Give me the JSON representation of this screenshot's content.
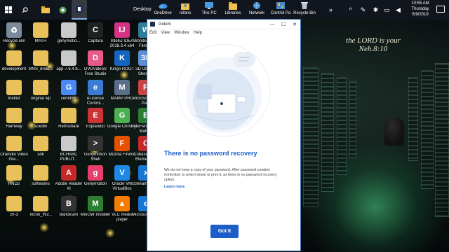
{
  "taskbar": {
    "desktop_label": "Desktop",
    "items": [
      {
        "label": "OneDrive",
        "icon": "cloud-icon"
      },
      {
        "label": "rufans",
        "icon": "user-folder-icon"
      },
      {
        "label": "This PC",
        "icon": "computer-icon"
      },
      {
        "label": "Libraries",
        "icon": "folder-icon"
      },
      {
        "label": "Network",
        "icon": "network-icon"
      },
      {
        "label": "Control Pa",
        "icon": "control-panel-icon"
      },
      {
        "label": "Recycle Bin",
        "icon": "recycle-bin-icon"
      }
    ],
    "clock": {
      "time": "10:55 AM",
      "day": "Thursday",
      "date": "5/9/2019"
    }
  },
  "wallpaper": {
    "verse_line1": "the LORD is your",
    "verse_line2": "Neh.8:10"
  },
  "desktop_icons": [
    {
      "label": "Recycle Bin",
      "color": "#7a8a9a",
      "glyph": "♻"
    },
    {
      "label": "development",
      "color": "#e8c15a",
      "glyph": ""
    },
    {
      "label": "Inetlist",
      "color": "#e8c15a",
      "glyph": ""
    },
    {
      "label": "Hamway",
      "color": "#e8c15a",
      "glyph": ""
    },
    {
      "label": "Oraindio Video Gre...",
      "color": "#e8c15a",
      "glyph": ""
    },
    {
      "label": "HND2",
      "color": "#e8c15a",
      "glyph": ""
    },
    {
      "label": "zh-3",
      "color": "#e8c15a",
      "glyph": ""
    },
    {
      "label": "MATH",
      "color": "#e8c15a",
      "glyph": ""
    },
    {
      "label": "MNS_droid...",
      "color": "#e8c15a",
      "glyph": ""
    },
    {
      "label": "original wp",
      "color": "#e8c15a",
      "glyph": ""
    },
    {
      "label": "scielbn",
      "color": "#e8c15a",
      "glyph": ""
    },
    {
      "label": "sdk",
      "color": "#e8c15a",
      "glyph": ""
    },
    {
      "label": "softwares",
      "color": "#e8c15a",
      "glyph": ""
    },
    {
      "label": "Tecno_W2...",
      "color": "#e8c15a",
      "glyph": ""
    },
    {
      "label": "genymotio...",
      "color": "#c9c9c9",
      "glyph": ""
    },
    {
      "label": "app-7.6.4.b...",
      "color": "#c9c9c9",
      "glyph": ""
    },
    {
      "label": "cenbhBr",
      "color": "#4a8af4",
      "glyph": "G"
    },
    {
      "label": "Retroshare",
      "color": "#e8c15a",
      "glyph": ""
    },
    {
      "label": "BCHABC PUBLIT...",
      "color": "#c9c9c9",
      "glyph": ""
    },
    {
      "label": "Adobe Reader XI",
      "color": "#c62828",
      "glyph": "A"
    },
    {
      "label": "Bandicam",
      "color": "#333",
      "glyph": "B"
    },
    {
      "label": "Captura",
      "color": "#222",
      "glyph": "C"
    },
    {
      "label": "DVDVideoS Free Studio",
      "color": "#e85a8a",
      "glyph": "D"
    },
    {
      "label": "eLicense Control...",
      "color": "#3a7bd5",
      "glyph": "e"
    },
    {
      "label": "Explandio",
      "color": "#c33",
      "glyph": "E"
    },
    {
      "label": "Genymotion Shell",
      "color": "#333",
      "glyph": ">"
    },
    {
      "label": "Genymotion",
      "color": "#e53f6c",
      "glyph": "g"
    },
    {
      "label": "MinGW Installer",
      "color": "#2e7d32",
      "glyph": "M"
    },
    {
      "label": "IntelliJ IDEA 2018.3.4 x64",
      "color": "#d63384",
      "glyph": "IJ"
    },
    {
      "label": "Kingo ROOT",
      "color": "#1565c0",
      "glyph": "K"
    },
    {
      "label": "MAMP PRO",
      "color": "#5b6f8a",
      "glyph": "M"
    },
    {
      "label": "Google Chrome",
      "color": "#4caf50",
      "glyph": "G"
    },
    {
      "label": "Mozilla Firefox",
      "color": "#e65100",
      "glyph": "F"
    },
    {
      "label": "Oracle VM VirtualBox",
      "color": "#1e88e5",
      "glyph": "V"
    },
    {
      "label": "VLC media player",
      "color": "#f57c00",
      "glyph": "▲"
    },
    {
      "label": "Wondershare Filmora",
      "color": "#2e7d9a",
      "glyph": "W"
    },
    {
      "label": "3D Objects Shortcut",
      "color": "#5c8fd6",
      "glyph": "3D"
    },
    {
      "label": "Microsoft RAR Pa...",
      "color": "#c44",
      "glyph": "R"
    },
    {
      "label": "ByteFence Anti-Malw...",
      "color": "#2e7d32",
      "glyph": "B"
    },
    {
      "label": "Cubase 5.1.5 Elements 9",
      "color": "#c62828",
      "glyph": "C"
    },
    {
      "label": "xStream Surfer",
      "color": "#1976d2",
      "glyph": "x"
    },
    {
      "label": "Microsoft Edge",
      "color": "#1976d2",
      "glyph": "e"
    }
  ],
  "window": {
    "title": "Golem",
    "menu": [
      "Edit",
      "View",
      "Window",
      "Help"
    ],
    "heading": "There is no password recovery",
    "body": "We do not keep a copy of your password. After password creation remember to write it down or print it, as there is no password recovery option.",
    "link": "Learn more",
    "button": "Got It"
  }
}
